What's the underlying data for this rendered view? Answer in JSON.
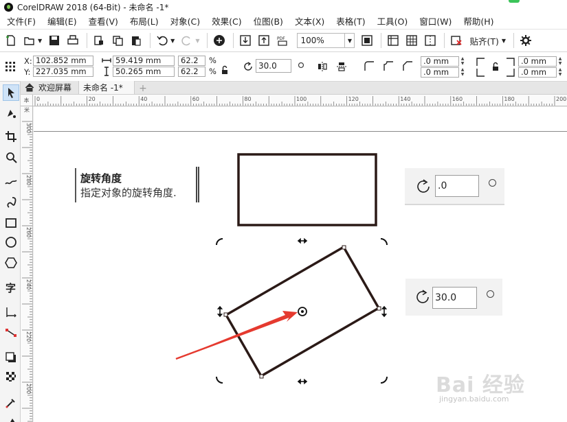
{
  "window": {
    "title": "CorelDRAW 2018 (64-Bit) - 未命名 -1*"
  },
  "menu": [
    "文件(F)",
    "编辑(E)",
    "查看(V)",
    "布局(L)",
    "对象(C)",
    "效果(C)",
    "位图(B)",
    "文本(X)",
    "表格(T)",
    "工具(O)",
    "窗口(W)",
    "帮助(H)"
  ],
  "toolbar": {
    "zoom": "100%",
    "snap": "贴齐(T)"
  },
  "props": {
    "x_label": "X:",
    "x_value": "102.852 mm",
    "y_label": "Y:",
    "y_value": "227.035 mm",
    "w_value": "59.419 mm",
    "h_value": "50.265 mm",
    "scale_w": "62.2",
    "scale_h": "62.2",
    "pct": "%",
    "rotation": "30.0",
    "corner1": ".0 mm",
    "corner2": ".0 mm",
    "corner3": ".0 mm",
    "corner4": ".0 mm"
  },
  "tabs": {
    "home": "欢迎屏幕",
    "doc": "未命名 -1*"
  },
  "ruler": {
    "h_ticks": [
      "0",
      "20",
      "40",
      "60",
      "80",
      "100",
      "120",
      "140",
      "160",
      "180",
      "200"
    ],
    "h_unit_left": "本",
    "v_ticks": [
      "300",
      "280",
      "260",
      "240",
      "220",
      "200"
    ],
    "v_unit_left": "米"
  },
  "tooltip": {
    "title": "旋转角度",
    "desc": "指定对象的旋转角度."
  },
  "rotation_panels": {
    "before": ".0",
    "after": "30.0"
  },
  "watermark": {
    "text": "Bai 经验",
    "url": "jingyan.baidu.com"
  },
  "colors": {
    "arrow": "#e53a2f",
    "accent": "#9dc3e8"
  }
}
